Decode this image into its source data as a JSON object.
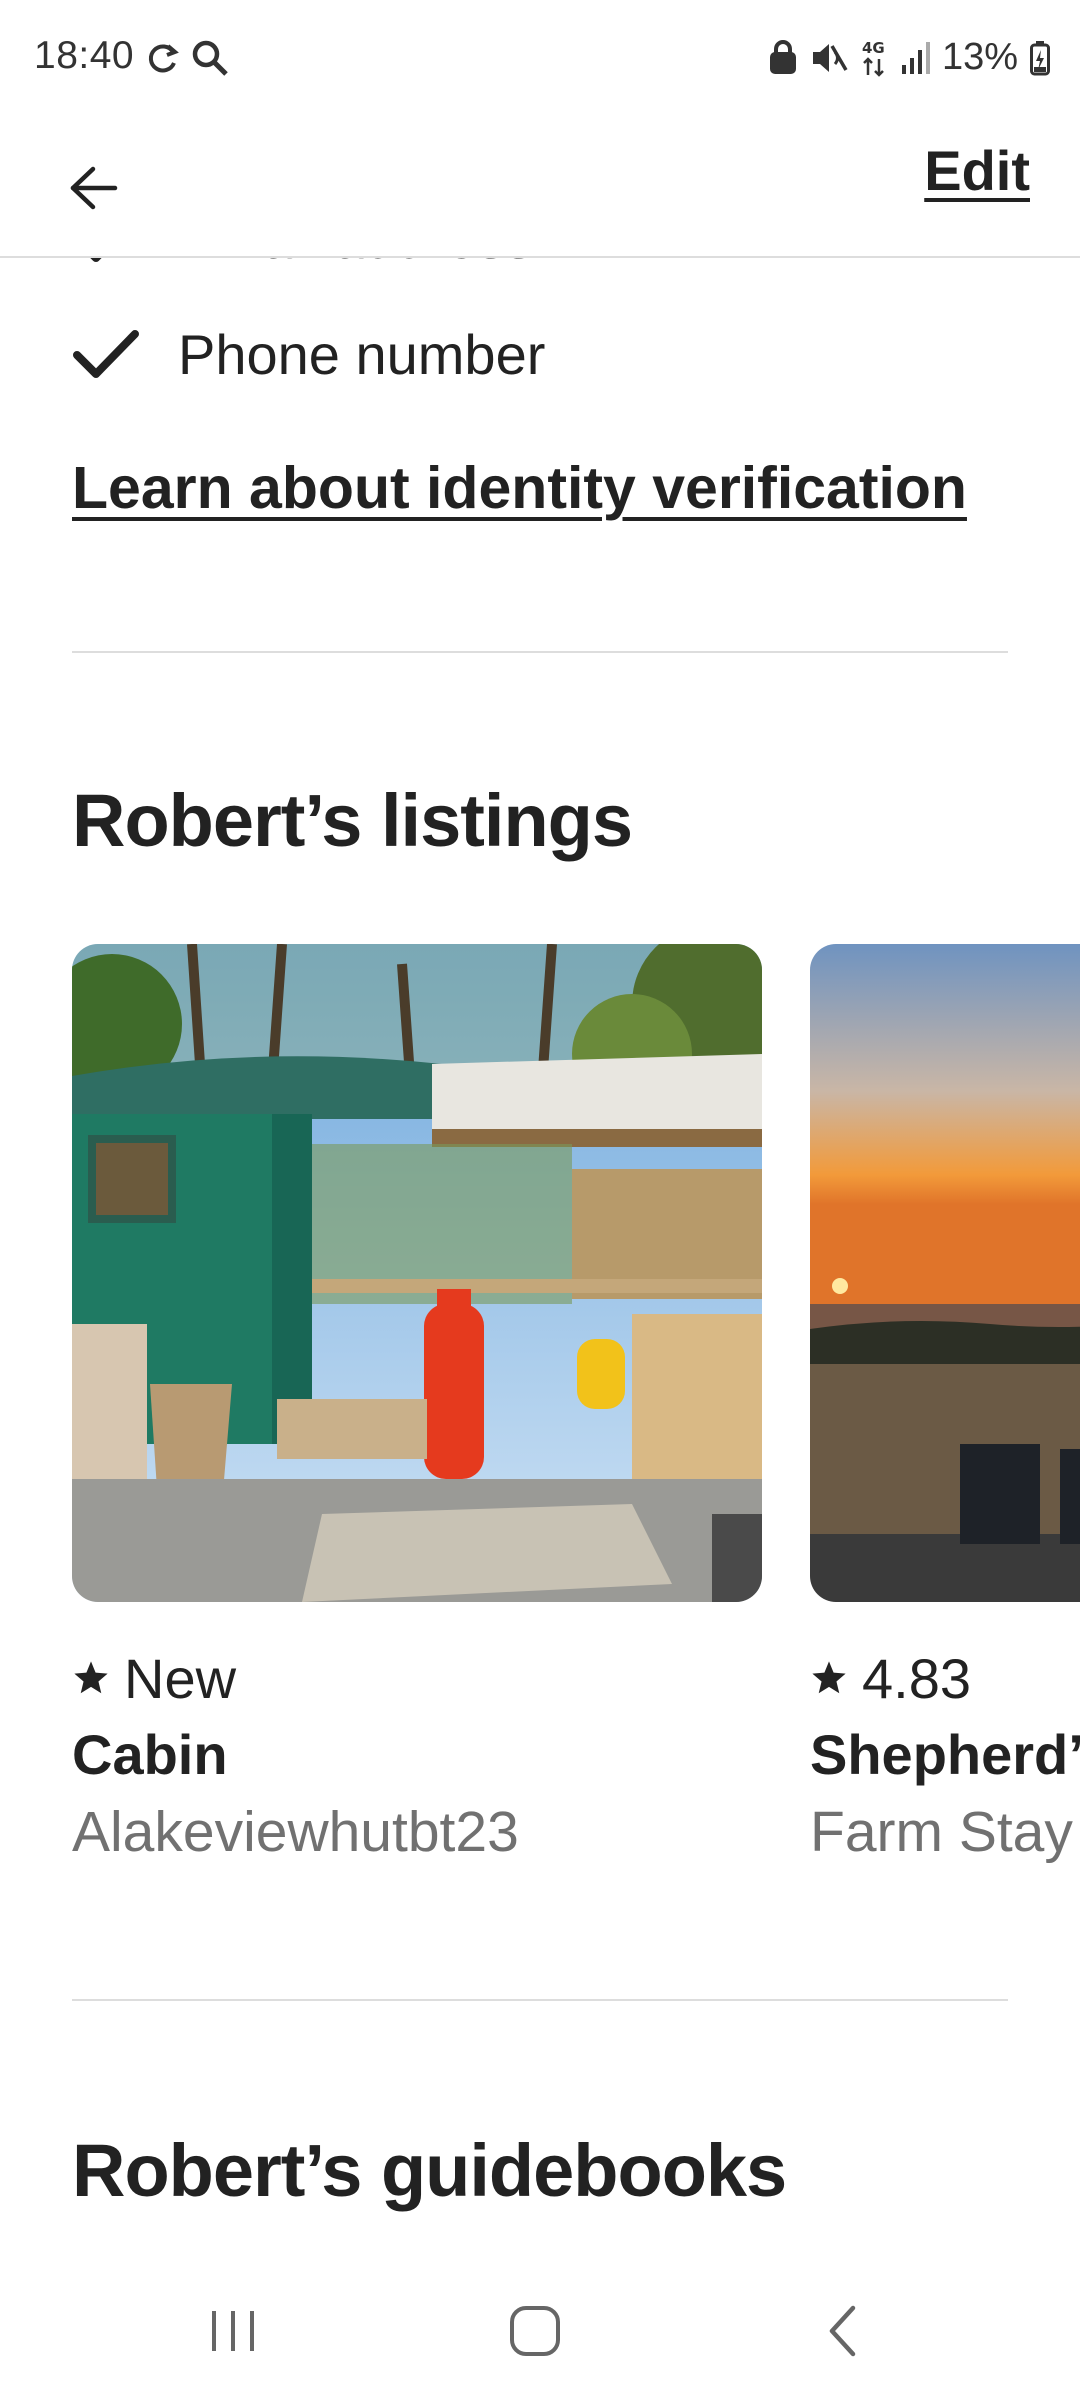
{
  "status_bar": {
    "time": "18:40",
    "battery": "13%",
    "network": "4G"
  },
  "app_bar": {
    "edit_label": "Edit"
  },
  "verification": {
    "items": [
      {
        "label": "Email address",
        "icon": "check-icon"
      },
      {
        "label": "Phone number",
        "icon": "check-icon"
      }
    ],
    "learn_link": "Learn about identity verification"
  },
  "listings": {
    "heading": "Robert’s listings",
    "cards": [
      {
        "rating": "New",
        "type": "Cabin",
        "subtitle": "Alakeviewhutbt23"
      },
      {
        "rating": "4.83",
        "type": "Shepherd’",
        "subtitle": "Farm Stay"
      }
    ]
  },
  "guidebooks": {
    "heading": "Robert’s guidebooks"
  },
  "colors": {
    "text": "#222222",
    "secondary_text": "#717171",
    "divider": "#dddddd"
  }
}
